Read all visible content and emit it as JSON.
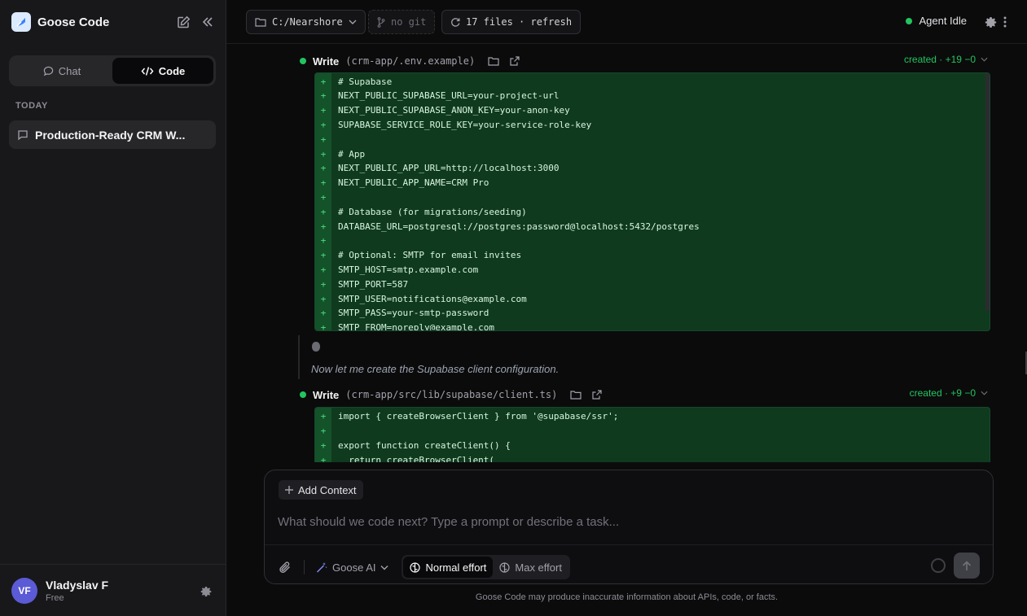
{
  "app": {
    "title": "Goose Code"
  },
  "sidebar": {
    "tabs": [
      {
        "label": "Chat"
      },
      {
        "label": "Code"
      }
    ],
    "section_label": "TODAY",
    "conversations": [
      {
        "title": "Production-Ready CRM W..."
      }
    ],
    "user": {
      "initials": "VF",
      "name": "Vladyslav F",
      "plan": "Free"
    }
  },
  "topbar": {
    "folder": "C:/Nearshore",
    "git": "no git",
    "files": "17 files · refresh",
    "agent_status": "Agent Idle"
  },
  "writes": [
    {
      "label": "Write",
      "path": "(crm-app/.env.example)",
      "status": "created · +19 −0",
      "lines": [
        "# Supabase",
        "NEXT_PUBLIC_SUPABASE_URL=your-project-url",
        "NEXT_PUBLIC_SUPABASE_ANON_KEY=your-anon-key",
        "SUPABASE_SERVICE_ROLE_KEY=your-service-role-key",
        "",
        "# App",
        "NEXT_PUBLIC_APP_URL=http://localhost:3000",
        "NEXT_PUBLIC_APP_NAME=CRM Pro",
        "",
        "# Database (for migrations/seeding)",
        "DATABASE_URL=postgresql://postgres:password@localhost:5432/postgres",
        "",
        "# Optional: SMTP for email invites",
        "SMTP_HOST=smtp.example.com",
        "SMTP_PORT=587",
        "SMTP_USER=notifications@example.com",
        "SMTP_PASS=your-smtp-password",
        "SMTP_FROM=noreply@example.com"
      ]
    },
    {
      "label": "Write",
      "path": "(crm-app/src/lib/supabase/client.ts)",
      "status": "created · +9 −0",
      "lines": [
        "import { createBrowserClient } from '@supabase/ssr';",
        "",
        "export function createClient() {",
        "  return createBrowserClient("
      ]
    }
  ],
  "thought": "Now let me create the Supabase client configuration.",
  "composer": {
    "add_context": "Add Context",
    "placeholder": "What should we code next? Type a prompt or describe a task...",
    "model": "Goose AI",
    "efforts": [
      {
        "label": "Normal effort"
      },
      {
        "label": "Max effort"
      }
    ]
  },
  "disclaimer": "Goose Code may produce inaccurate information about APIs, code, or facts.",
  "colors": {
    "accent_green": "#22c55e",
    "diff_bg": "#0f3a1e",
    "avatar": "#5b5bd6"
  }
}
